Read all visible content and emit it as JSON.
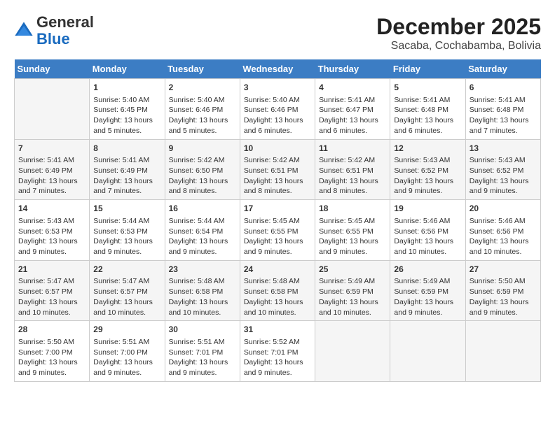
{
  "logo": {
    "text_general": "General",
    "text_blue": "Blue"
  },
  "title": "December 2025",
  "subtitle": "Sacaba, Cochabamba, Bolivia",
  "days_of_week": [
    "Sunday",
    "Monday",
    "Tuesday",
    "Wednesday",
    "Thursday",
    "Friday",
    "Saturday"
  ],
  "weeks": [
    [
      {
        "num": "",
        "info": ""
      },
      {
        "num": "1",
        "info": "Sunrise: 5:40 AM\nSunset: 6:45 PM\nDaylight: 13 hours\nand 5 minutes."
      },
      {
        "num": "2",
        "info": "Sunrise: 5:40 AM\nSunset: 6:46 PM\nDaylight: 13 hours\nand 5 minutes."
      },
      {
        "num": "3",
        "info": "Sunrise: 5:40 AM\nSunset: 6:46 PM\nDaylight: 13 hours\nand 6 minutes."
      },
      {
        "num": "4",
        "info": "Sunrise: 5:41 AM\nSunset: 6:47 PM\nDaylight: 13 hours\nand 6 minutes."
      },
      {
        "num": "5",
        "info": "Sunrise: 5:41 AM\nSunset: 6:48 PM\nDaylight: 13 hours\nand 6 minutes."
      },
      {
        "num": "6",
        "info": "Sunrise: 5:41 AM\nSunset: 6:48 PM\nDaylight: 13 hours\nand 7 minutes."
      }
    ],
    [
      {
        "num": "7",
        "info": "Sunrise: 5:41 AM\nSunset: 6:49 PM\nDaylight: 13 hours\nand 7 minutes."
      },
      {
        "num": "8",
        "info": "Sunrise: 5:41 AM\nSunset: 6:49 PM\nDaylight: 13 hours\nand 7 minutes."
      },
      {
        "num": "9",
        "info": "Sunrise: 5:42 AM\nSunset: 6:50 PM\nDaylight: 13 hours\nand 8 minutes."
      },
      {
        "num": "10",
        "info": "Sunrise: 5:42 AM\nSunset: 6:51 PM\nDaylight: 13 hours\nand 8 minutes."
      },
      {
        "num": "11",
        "info": "Sunrise: 5:42 AM\nSunset: 6:51 PM\nDaylight: 13 hours\nand 8 minutes."
      },
      {
        "num": "12",
        "info": "Sunrise: 5:43 AM\nSunset: 6:52 PM\nDaylight: 13 hours\nand 9 minutes."
      },
      {
        "num": "13",
        "info": "Sunrise: 5:43 AM\nSunset: 6:52 PM\nDaylight: 13 hours\nand 9 minutes."
      }
    ],
    [
      {
        "num": "14",
        "info": "Sunrise: 5:43 AM\nSunset: 6:53 PM\nDaylight: 13 hours\nand 9 minutes."
      },
      {
        "num": "15",
        "info": "Sunrise: 5:44 AM\nSunset: 6:53 PM\nDaylight: 13 hours\nand 9 minutes."
      },
      {
        "num": "16",
        "info": "Sunrise: 5:44 AM\nSunset: 6:54 PM\nDaylight: 13 hours\nand 9 minutes."
      },
      {
        "num": "17",
        "info": "Sunrise: 5:45 AM\nSunset: 6:55 PM\nDaylight: 13 hours\nand 9 minutes."
      },
      {
        "num": "18",
        "info": "Sunrise: 5:45 AM\nSunset: 6:55 PM\nDaylight: 13 hours\nand 9 minutes."
      },
      {
        "num": "19",
        "info": "Sunrise: 5:46 AM\nSunset: 6:56 PM\nDaylight: 13 hours\nand 10 minutes."
      },
      {
        "num": "20",
        "info": "Sunrise: 5:46 AM\nSunset: 6:56 PM\nDaylight: 13 hours\nand 10 minutes."
      }
    ],
    [
      {
        "num": "21",
        "info": "Sunrise: 5:47 AM\nSunset: 6:57 PM\nDaylight: 13 hours\nand 10 minutes."
      },
      {
        "num": "22",
        "info": "Sunrise: 5:47 AM\nSunset: 6:57 PM\nDaylight: 13 hours\nand 10 minutes."
      },
      {
        "num": "23",
        "info": "Sunrise: 5:48 AM\nSunset: 6:58 PM\nDaylight: 13 hours\nand 10 minutes."
      },
      {
        "num": "24",
        "info": "Sunrise: 5:48 AM\nSunset: 6:58 PM\nDaylight: 13 hours\nand 10 minutes."
      },
      {
        "num": "25",
        "info": "Sunrise: 5:49 AM\nSunset: 6:59 PM\nDaylight: 13 hours\nand 10 minutes."
      },
      {
        "num": "26",
        "info": "Sunrise: 5:49 AM\nSunset: 6:59 PM\nDaylight: 13 hours\nand 9 minutes."
      },
      {
        "num": "27",
        "info": "Sunrise: 5:50 AM\nSunset: 6:59 PM\nDaylight: 13 hours\nand 9 minutes."
      }
    ],
    [
      {
        "num": "28",
        "info": "Sunrise: 5:50 AM\nSunset: 7:00 PM\nDaylight: 13 hours\nand 9 minutes."
      },
      {
        "num": "29",
        "info": "Sunrise: 5:51 AM\nSunset: 7:00 PM\nDaylight: 13 hours\nand 9 minutes."
      },
      {
        "num": "30",
        "info": "Sunrise: 5:51 AM\nSunset: 7:01 PM\nDaylight: 13 hours\nand 9 minutes."
      },
      {
        "num": "31",
        "info": "Sunrise: 5:52 AM\nSunset: 7:01 PM\nDaylight: 13 hours\nand 9 minutes."
      },
      {
        "num": "",
        "info": ""
      },
      {
        "num": "",
        "info": ""
      },
      {
        "num": "",
        "info": ""
      }
    ]
  ]
}
